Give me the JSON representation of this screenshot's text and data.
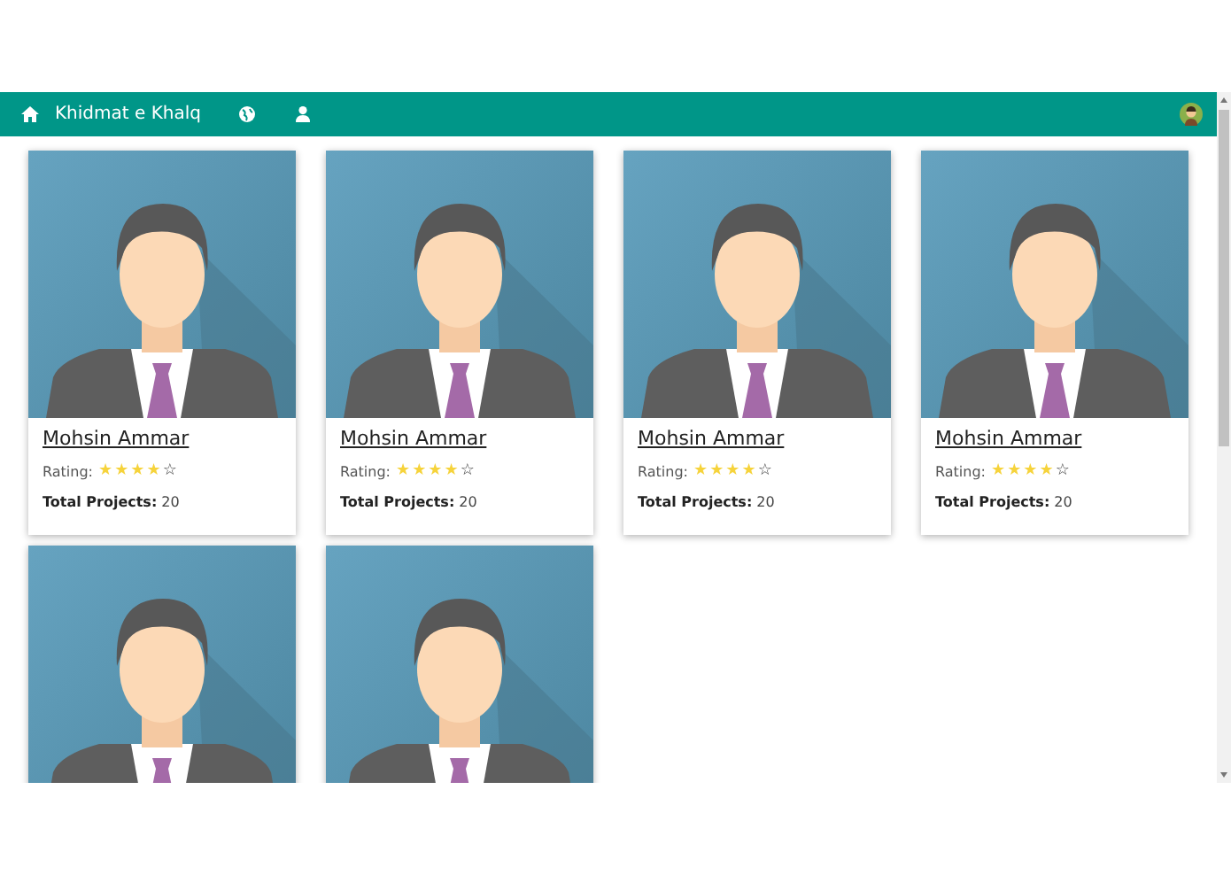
{
  "navbar": {
    "brand": "Khidmat e Khalq"
  },
  "cards": [
    {
      "kind": "full",
      "name": "Mohsin Ammar",
      "rating_label": "Rating:",
      "stars": 4,
      "projects": "**Total Projects:** 20"
    },
    {
      "kind": "full",
      "name": "Mohsin Ammar",
      "rating_label": "Rating:",
      "stars": 4,
      "projects": "**Total Projects:** 20"
    },
    {
      "kind": "full",
      "name": "Mohsin Ammar",
      "rating_label": "Rating:",
      "stars": 4,
      "projects": "**Total Projects:** 20"
    },
    {
      "kind": "full",
      "name": "Mohsin Ammar",
      "rating_label": "Rating:",
      "stars": 4,
      "projects": "**Total Projects:** 20"
    },
    {
      "kind": "clipped"
    },
    {
      "kind": "clipped"
    }
  ]
}
